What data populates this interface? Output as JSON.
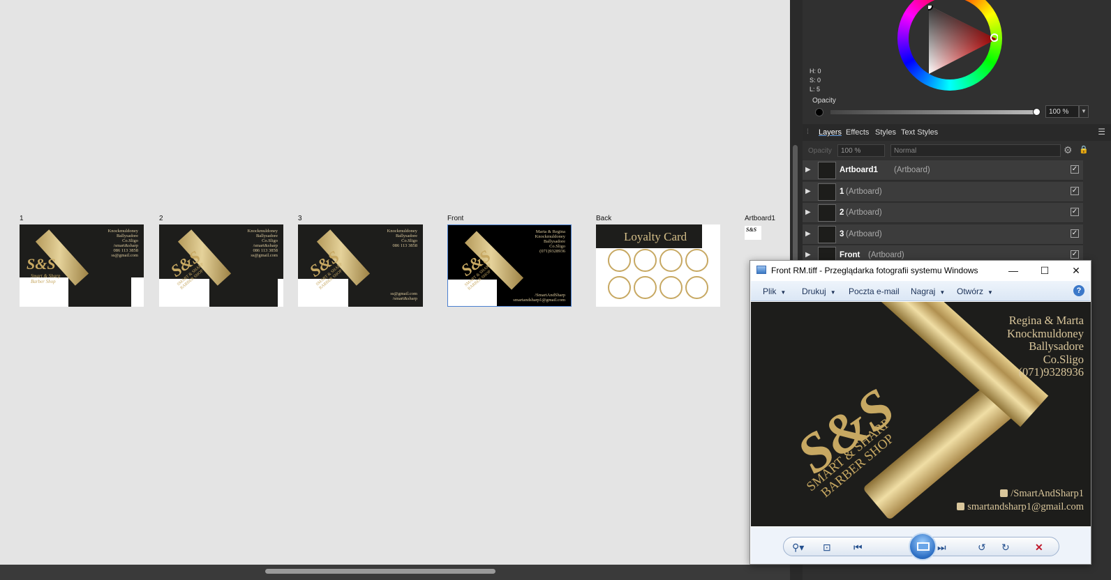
{
  "canvas": {
    "artboards": [
      {
        "label": "1",
        "address": "Knockmuldoney\nBallysadore\nCo.Sligo\n/smart&sharp\n086 113 3858\nss@gmail.com",
        "monogram": "S&S",
        "brand": "Smart & Sharp\nBarber Shop"
      },
      {
        "label": "2",
        "address": "Knockmuldoney\nBallysadore\nCo.Sligo\n/smart&sharp\n086 113 3858\nss@gmail.com",
        "monogram": "S&S",
        "brand": "SMART & SHARP\nBARBER SHOP"
      },
      {
        "label": "3",
        "address": "Knockmuldoney\nBallysadore\nCo.Sligo\n086 113 3858",
        "monogram": "S&S",
        "brand": "SMART & SHARP\nBARBER SHOP",
        "social": "ss@gmail.com\n/smart&sharp"
      },
      {
        "label": "Front",
        "address": "Marta & Regina\nKnockmuldoney\nBallysadore\nCo.Sligo\n(071)9328936",
        "monogram": "S&S",
        "brand": "SMART & SHARP\nBARBER SHOP",
        "social": "/SmartAndSharp\nsmartandsharp1@gmail.com"
      },
      {
        "label": "Back",
        "title": "Loyalty Card",
        "stamp_count": 8
      },
      {
        "label": "Artboard1",
        "monogram": "S&S"
      }
    ]
  },
  "panel": {
    "hsl": {
      "h": "H: 0",
      "s": "S: 0",
      "l": "L: 5"
    },
    "opacity_label": "Opacity",
    "opacity_value": "100 %",
    "opacity_level": 1.0,
    "tabs": [
      "Layers",
      "Effects",
      "Styles",
      "Text Styles"
    ],
    "active_tab": "Layers",
    "layer_opacity_label": "Opacity",
    "layer_opacity_value": "100 %",
    "blend_mode": "Normal",
    "layers": [
      {
        "name": "Artboard1",
        "type": "(Artboard)",
        "visible": true
      },
      {
        "name": "1",
        "type": "(Artboard)",
        "visible": true
      },
      {
        "name": "2",
        "type": "(Artboard)",
        "visible": true
      },
      {
        "name": "3",
        "type": "(Artboard)",
        "visible": true
      },
      {
        "name": "Front",
        "type": "(Artboard)",
        "visible": true
      }
    ],
    "colors": {
      "accent": "#6aa4e8",
      "gold": "#c7a862",
      "bg": "#303030"
    }
  },
  "viewer": {
    "title": "Front RM.tiff - Przeglądarka fotografii systemu Windows",
    "menu": [
      "Plik",
      "Drukuj",
      "Poczta e-mail",
      "Nagraj",
      "Otwórz"
    ],
    "help": "?",
    "image": {
      "monogram": "S&S",
      "brand": "SMART & SHARP\nBARBER SHOP",
      "address": "Regina & Marta\nKnockmuldoney\nBallysadore\nCo.Sligo\n(071)9328936",
      "facebook": "/SmartAndSharp1",
      "email": "smartandsharp1@gmail.com"
    },
    "window_buttons": {
      "minimize": "—",
      "maximize": "☐",
      "close": "✕"
    }
  }
}
